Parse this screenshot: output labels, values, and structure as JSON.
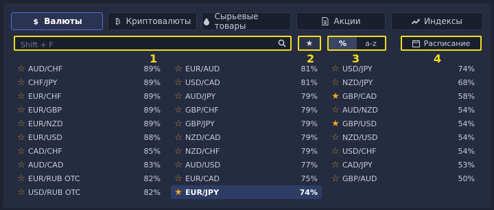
{
  "tabs": [
    {
      "label": "Валюты",
      "icon": "dollar-icon",
      "glyph": "$",
      "active": true
    },
    {
      "label": "Криптовалюты",
      "icon": "bitcoin-icon",
      "glyph": "₿",
      "active": false
    },
    {
      "label": "Сырьевые товары",
      "icon": "drop-icon",
      "glyph": "",
      "active": false
    },
    {
      "label": "Акции",
      "icon": "document-icon",
      "glyph": "",
      "active": false
    },
    {
      "label": "Индексы",
      "icon": "trend-up-icon",
      "glyph": "",
      "active": false
    }
  ],
  "search": {
    "placeholder": "Shift + F",
    "value": ""
  },
  "sort": {
    "percent_label": "%",
    "alpha_label": "a-z",
    "active": "percent"
  },
  "schedule": {
    "label": "Расписание"
  },
  "annotations": [
    "1",
    "2",
    "3",
    "4"
  ],
  "columns": [
    [
      {
        "name": "AUD/CHF",
        "pct": "89%",
        "fav": false
      },
      {
        "name": "CHF/JPY",
        "pct": "89%",
        "fav": false
      },
      {
        "name": "EUR/CHF",
        "pct": "89%",
        "fav": false
      },
      {
        "name": "EUR/GBP",
        "pct": "89%",
        "fav": false
      },
      {
        "name": "EUR/NZD",
        "pct": "89%",
        "fav": false
      },
      {
        "name": "EUR/USD",
        "pct": "88%",
        "fav": false
      },
      {
        "name": "CAD/CHF",
        "pct": "85%",
        "fav": false
      },
      {
        "name": "AUD/CAD",
        "pct": "83%",
        "fav": false
      },
      {
        "name": "EUR/RUB OTC",
        "pct": "82%",
        "fav": false
      },
      {
        "name": "USD/RUB OTC",
        "pct": "82%",
        "fav": false
      }
    ],
    [
      {
        "name": "EUR/AUD",
        "pct": "81%",
        "fav": false
      },
      {
        "name": "USD/CAD",
        "pct": "81%",
        "fav": false
      },
      {
        "name": "AUD/JPY",
        "pct": "79%",
        "fav": false
      },
      {
        "name": "GBP/CHF",
        "pct": "79%",
        "fav": false
      },
      {
        "name": "GBP/JPY",
        "pct": "79%",
        "fav": false
      },
      {
        "name": "NZD/CAD",
        "pct": "79%",
        "fav": false
      },
      {
        "name": "NZD/CHF",
        "pct": "79%",
        "fav": false
      },
      {
        "name": "AUD/USD",
        "pct": "77%",
        "fav": false
      },
      {
        "name": "EUR/CAD",
        "pct": "75%",
        "fav": false
      },
      {
        "name": "EUR/JPY",
        "pct": "74%",
        "fav": true,
        "selected": true
      }
    ],
    [
      {
        "name": "USD/JPY",
        "pct": "74%",
        "fav": false
      },
      {
        "name": "NZD/JPY",
        "pct": "68%",
        "fav": false
      },
      {
        "name": "GBP/CAD",
        "pct": "58%",
        "fav": true
      },
      {
        "name": "AUD/NZD",
        "pct": "54%",
        "fav": false
      },
      {
        "name": "GBP/USD",
        "pct": "54%",
        "fav": true
      },
      {
        "name": "NZD/USD",
        "pct": "54%",
        "fav": false
      },
      {
        "name": "USD/CHF",
        "pct": "54%",
        "fav": false
      },
      {
        "name": "CAD/JPY",
        "pct": "53%",
        "fav": false
      },
      {
        "name": "GBP/AUD",
        "pct": "50%",
        "fav": false
      }
    ]
  ],
  "colors": {
    "accent": "#4f6fe0",
    "highlight": "#f2df1b",
    "star_on": "#f5a623",
    "star_off": "#b88b2a",
    "selected_row": "#2d3d66"
  }
}
